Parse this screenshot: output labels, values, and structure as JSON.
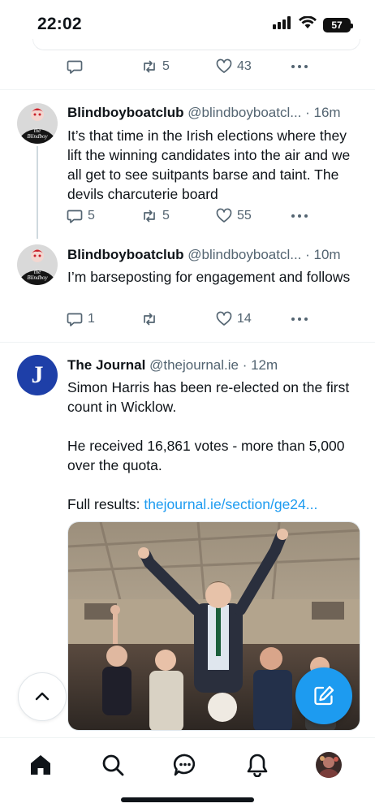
{
  "status_bar": {
    "time": "22:02",
    "battery": "57"
  },
  "colors": {
    "accent": "#1d9bf0",
    "secondary_text": "#536471",
    "journal_brand": "#1e3fa8"
  },
  "tweets": [
    {
      "reply_count": "",
      "retweet_count": "5",
      "like_count": "43"
    },
    {
      "name": "Blindboyboatclub",
      "handle": "@blindboyboatcl...",
      "time": "· 16m",
      "text": "It’s that time in the Irish elections where they lift the winning candidates into the air and we all get to see suitpants barse and taint. The devils charcuterie board",
      "reply_count": "5",
      "retweet_count": "5",
      "like_count": "55"
    },
    {
      "name": "Blindboyboatclub",
      "handle": "@blindboyboatcl...",
      "time": "· 10m",
      "text": "I’m barseposting for engagement and follows",
      "reply_count": "1",
      "retweet_count": "",
      "like_count": "14"
    },
    {
      "name": "The Journal",
      "handle": "@thejournal.ie",
      "time": "· 12m",
      "avatar_letter": "J",
      "text_line1": "Simon Harris has been re-elected on the first count in Wicklow.",
      "text_line2": "He received 16,861 votes - more than 5,000 over the quota.",
      "text_line3_prefix": "Full results: ",
      "text_line3_link": "thejournal.ie/section/ge24...",
      "media_icon": "photo-of-candidate-lifted-by-crowd"
    }
  ],
  "tabbar": {
    "items": [
      "home-icon",
      "search-icon",
      "messages-icon",
      "notifications-icon",
      "profile-avatar"
    ]
  }
}
